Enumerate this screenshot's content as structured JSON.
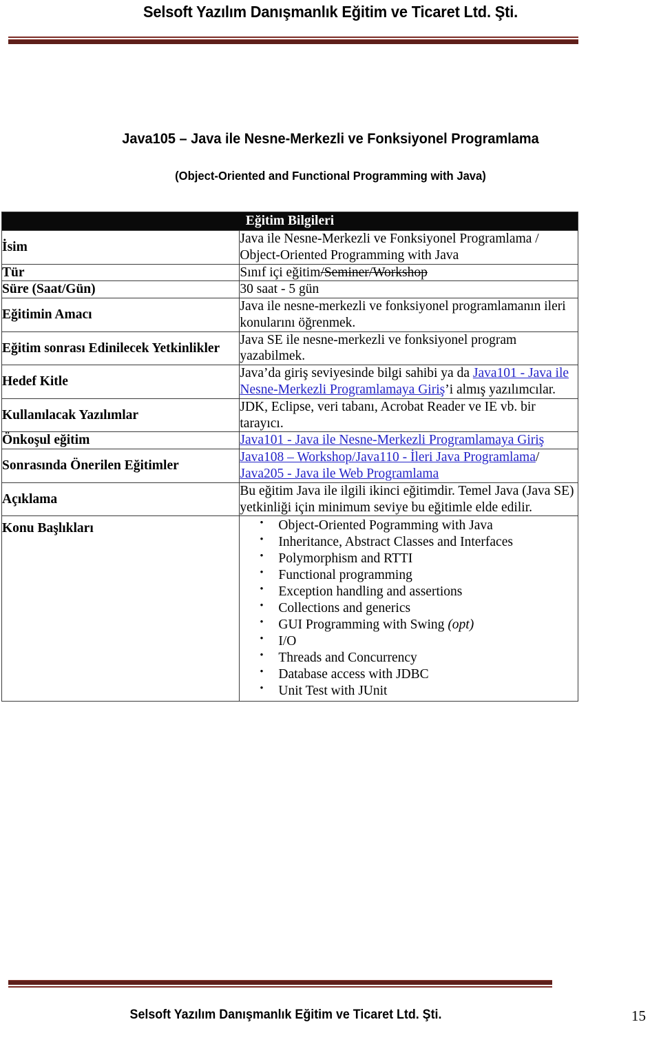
{
  "header": {
    "company_title": "Selsoft Yazılım Danışmanlık Eğitim ve Ticaret Ltd. Şti.",
    "rule_color": "#5e1f1a"
  },
  "course": {
    "title": "Java105 – Java ile Nesne-Merkezli ve Fonksiyonel Programlama",
    "subtitle": "(Object-Oriented and Functional Programming with Java)"
  },
  "table": {
    "header": "Eğitim Bilgileri",
    "rows": [
      {
        "label": "İsim",
        "value": "Java ile Nesne-Merkezli ve Fonksiyonel Programlama / Object-Oriented Programming with Java"
      },
      {
        "label": "Tür",
        "value_normal": "Sınıf içi eğitim",
        "value_struck": "/Seminer/Workshop"
      },
      {
        "label": "Süre (Saat/Gün)",
        "value": "30 saat - 5 gün"
      },
      {
        "label": "Eğitimin Amacı",
        "value": "Java ile nesne-merkezli ve fonksiyonel programlamanın ileri konularını öğrenmek."
      },
      {
        "label": "Eğitim sonrası Edinilecek Yetkinlikler",
        "value": "Java SE ile nesne-merkezli ve fonksiyonel program yazabilmek."
      },
      {
        "label": "Hedef Kitle",
        "value_prefix": "Java’da giriş seviyesinde bilgi sahibi ya da ",
        "value_link": "Java101 - Java ile Nesne-Merkezli Programlamaya Giriş",
        "value_suffix": "’i almış yazılımcılar."
      },
      {
        "label": "Kullanılacak Yazılımlar",
        "value": "JDK, Eclipse, veri tabanı, Acrobat Reader ve IE vb. bir tarayıcı."
      },
      {
        "label": "Önkoşul eğitim",
        "value_link": "Java101 - Java ile Nesne-Merkezli Programlamaya Giriş"
      },
      {
        "label": "Sonrasında Önerilen Eğitimler",
        "value_link_1": "Java108 – Workshop/Java110 - İleri Java Programlama",
        "value_separator": "/ ",
        "value_link_2": "Java205 - Java ile Web Programlama"
      },
      {
        "label": "Açıklama",
        "value": "Bu eğitim Java ile ilgili ikinci eğitimdir. Temel Java (Java SE) yetkinliği için minimum seviye bu eğitimle elde edilir."
      },
      {
        "label": "Konu Başlıkları",
        "topics": [
          {
            "text": "Object-Oriented Pogramming with Java",
            "suffix": ""
          },
          {
            "text": "Inheritance, Abstract Classes and Interfaces",
            "suffix": ""
          },
          {
            "text": "Polymorphism and RTTI",
            "suffix": ""
          },
          {
            "text": "Functional programming",
            "suffix": ""
          },
          {
            "text": "Exception handling and assertions",
            "suffix": ""
          },
          {
            "text": "Collections and generics",
            "suffix": ""
          },
          {
            "text": "GUI Programming with Swing ",
            "suffix": "(opt)"
          },
          {
            "text": "I/O",
            "suffix": ""
          },
          {
            "text": "Threads and Concurrency",
            "suffix": ""
          },
          {
            "text": "Database access with JDBC",
            "suffix": ""
          },
          {
            "text": "Unit Test with JUnit",
            "suffix": ""
          }
        ]
      }
    ]
  },
  "footer": {
    "company_title": "Selsoft Yazılım Danışmanlık Eğitim ve Ticaret Ltd. Şti.",
    "page_number": "15"
  }
}
